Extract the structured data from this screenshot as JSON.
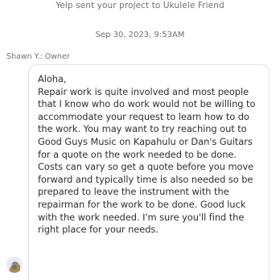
{
  "system_note": "Yelp sent your project to Ukulele Friend",
  "timestamp": "Sep 30, 2023, 9:53AM",
  "message": {
    "sender": "Shawn Y.: Owner",
    "text": "Aloha,\nRepair work is quite involved and most people that I know who do work would not be willing to accommodate your request to learn how to do the work. You may want to try reaching out to Good Guys Music on Kapahulu or Dan's Guitars for a quote on the work needed to be done. Costs can vary so get a quote before you move forward and typically time is also needed so be prepared to leave the instrument with the repairman for the work to be done. Good luck with the work needed. I'm sure you'll find the right place for your needs.",
    "avatar_icon": "user-avatar-icon"
  },
  "colors": {
    "muted_text": "#6e7072",
    "body_text": "#2d2e2f",
    "bubble_border": "#e0e0e0"
  }
}
